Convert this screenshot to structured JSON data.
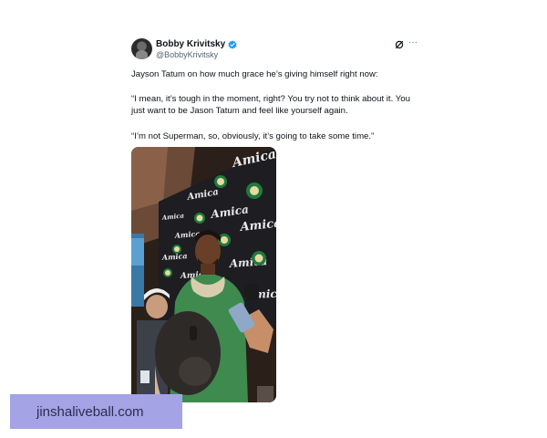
{
  "tweet": {
    "author_name": "Bobby Krivitsky",
    "author_handle": "@BobbyKrivitsky",
    "paragraph_1": "Jayson Tatum on how much grace he’s giving himself right now:",
    "paragraph_2_line_1": "“I mean, it’s tough in the moment, right? You try not to think about it. You",
    "paragraph_2_line_2": "just want to be Jason Tatum and feel like yourself again.",
    "paragraph_3": "“I’m not Superman, so, obviously, it’s going to take some time.”",
    "more_label": "···"
  },
  "media": {
    "backdrop_logo_text": "Amica"
  },
  "watermark": {
    "text": "jinshaliveball.com"
  },
  "colors": {
    "verified_badge": "#1d9bf0",
    "watermark_bg": "#a4a3e5",
    "handle_gray": "#536471"
  }
}
